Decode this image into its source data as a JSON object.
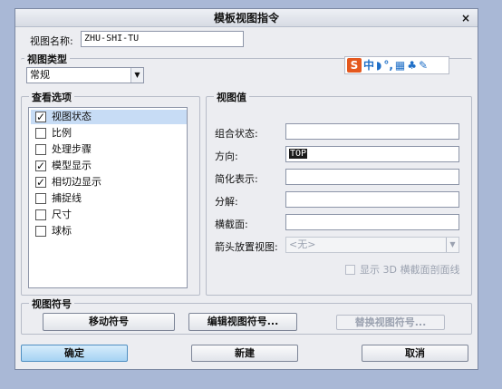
{
  "window": {
    "title": "模板视图指令",
    "close_glyph": "×"
  },
  "view_name": {
    "label": "视图名称:",
    "value": "ZHU-SHI-TU"
  },
  "view_type": {
    "title": "视图类型",
    "value": "常规"
  },
  "ime_toolbar": {
    "logo": "S",
    "mode": "中",
    "icons": [
      "moon-icon",
      "punctuation-icon",
      "keyboard-icon",
      "skin-icon",
      "wrench-icon"
    ]
  },
  "view_options": {
    "title": "查看选项",
    "items": [
      {
        "label": "视图状态",
        "checked": true,
        "selected": true
      },
      {
        "label": "比例",
        "checked": false
      },
      {
        "label": "处理步骤",
        "checked": false
      },
      {
        "label": "模型显示",
        "checked": true
      },
      {
        "label": "相切边显示",
        "checked": true
      },
      {
        "label": "捕捉线",
        "checked": false
      },
      {
        "label": "尺寸",
        "checked": false
      },
      {
        "label": "球标",
        "checked": false
      }
    ]
  },
  "view_values": {
    "title": "视图值",
    "combined_state": {
      "label": "组合状态:",
      "value": ""
    },
    "orientation": {
      "label": "方向:",
      "value": "TOP"
    },
    "simplified": {
      "label": "简化表示:",
      "value": ""
    },
    "explode": {
      "label": "分解:",
      "value": ""
    },
    "cross_section": {
      "label": "横截面:",
      "value": ""
    },
    "arrow_view": {
      "label": "箭头放置视图:",
      "value": "<无>"
    },
    "show_3d_checkbox": {
      "label": "显示 3D 横截面剖面线",
      "checked": false
    }
  },
  "view_symbol": {
    "title": "视图符号",
    "move": "移动符号",
    "edit": "编辑视图符号...",
    "replace": "替换视图符号..."
  },
  "footer": {
    "ok": "确定",
    "new": "新建",
    "cancel": "取消"
  },
  "colors": {
    "accent": "#a6d3f3",
    "selection": "#c7dcf5",
    "background": "#a9b8d6"
  }
}
